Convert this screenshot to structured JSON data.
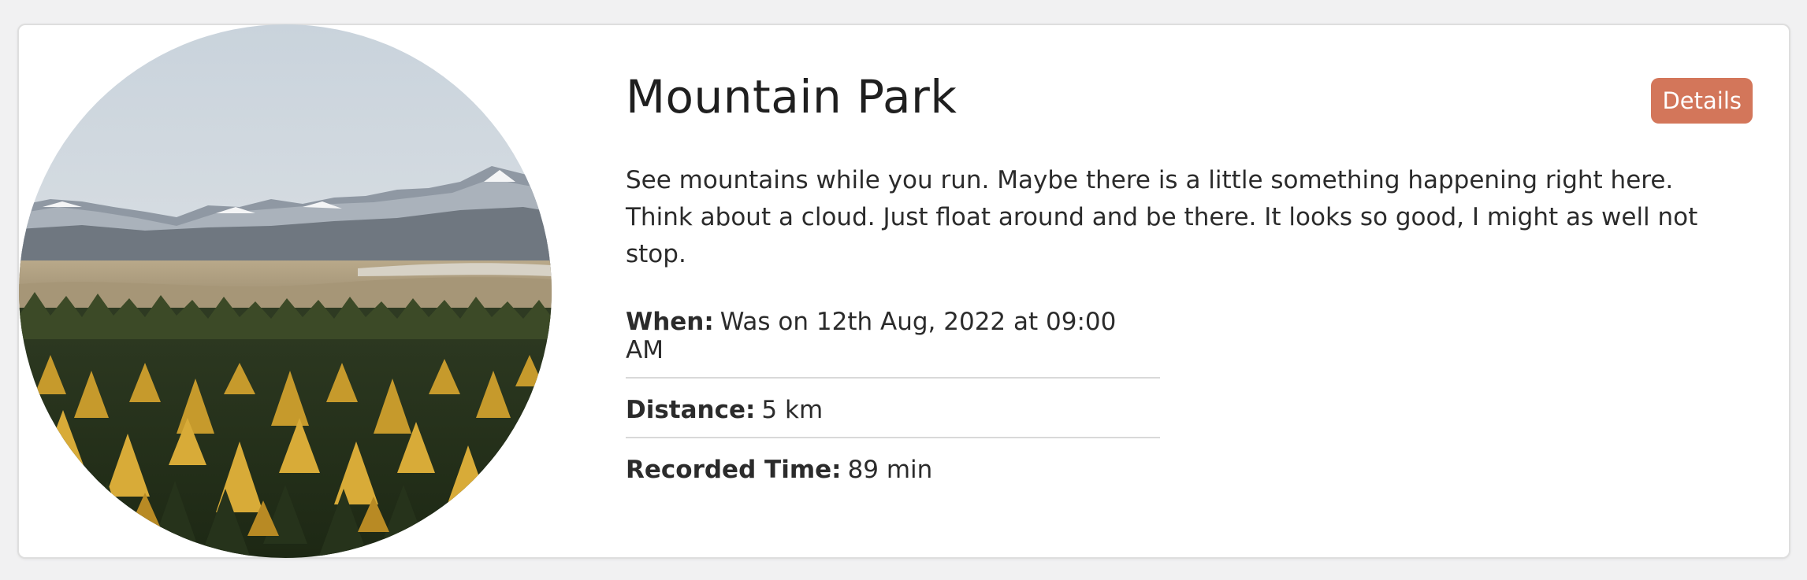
{
  "card": {
    "title": "Mountain Park",
    "details_button": "Details",
    "description": "See mountains while you run. Maybe there is a little something happening right here. Think about a cloud. Just float around and be there. It looks so good, I might as well not stop.",
    "image_alt": "mountain-forest-landscape"
  },
  "facts": {
    "when_label": "When:",
    "when_value": "Was on 12th Aug, 2022 at 09:00 AM",
    "distance_label": "Distance:",
    "distance_value": "5 km",
    "time_label": "Recorded Time:",
    "time_value": "89 min"
  },
  "colors": {
    "accent": "#d3765a",
    "background": "#f1f1f2",
    "card": "#ffffff"
  }
}
